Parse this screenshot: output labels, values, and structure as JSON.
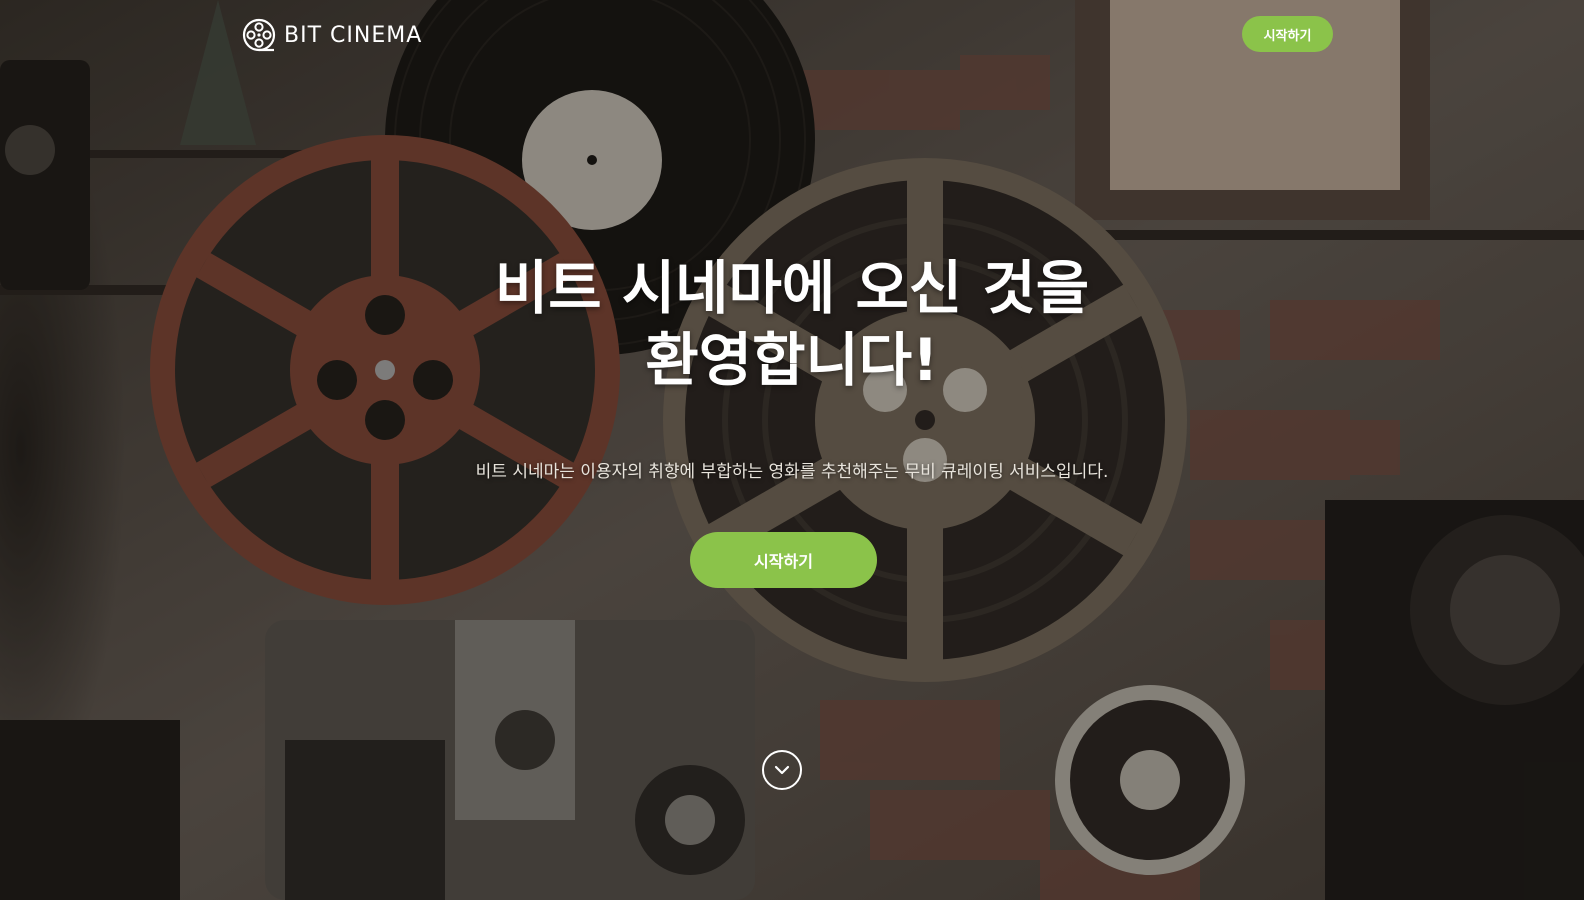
{
  "brand": {
    "name": "BIT CINEMA",
    "logo_icon": "film-reel-icon"
  },
  "header": {
    "start_label": "시작하기"
  },
  "hero": {
    "headline_line1": "비트 시네마에 오신 것을",
    "headline_line2": "환영합니다!",
    "subtitle": "비트 시네마는 이용자의 취향에 부합하는 영화를 추천해주는 무비 큐레이팅 서비스입니다.",
    "start_label": "시작하기",
    "scroll_icon": "chevron-down-icon",
    "background_image": "film-reels-and-projectors-photo"
  },
  "colors": {
    "accent": "#8bc34a",
    "text": "#ffffff"
  }
}
